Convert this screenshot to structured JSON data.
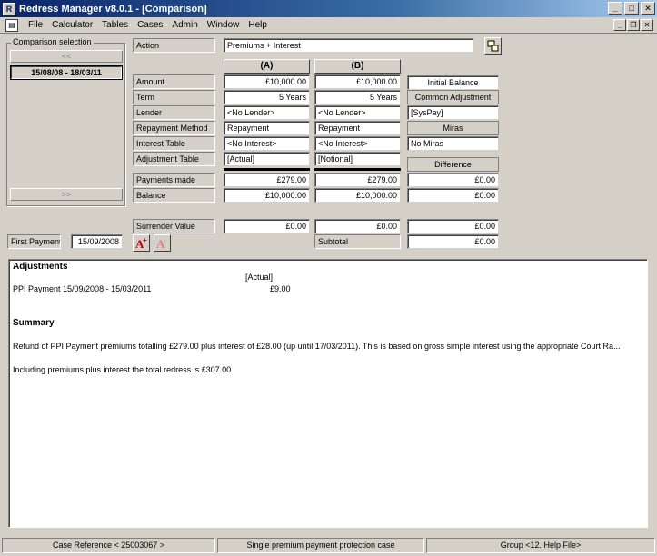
{
  "window": {
    "title": "Redress Manager v8.0.1 - [Comparison]",
    "controls": {
      "minimize": "_",
      "maximize": "□",
      "close": "✕"
    },
    "mdi_controls": {
      "minimize": "_",
      "restore": "❐",
      "close": "✕"
    }
  },
  "menu": [
    "File",
    "Calculator",
    "Tables",
    "Cases",
    "Admin",
    "Window",
    "Help"
  ],
  "comparison_selection": {
    "title": "Comparison selection",
    "prev_button": "<<",
    "next_button": ">>",
    "selected_item": "15/08/08 - 18/03/11"
  },
  "action": {
    "label": "Action",
    "value": "Premiums + Interest"
  },
  "columns": {
    "a": "(A)",
    "b": "(B)"
  },
  "rows": {
    "amount": {
      "label": "Amount",
      "a": "£10,000.00",
      "b": "£10,000.00"
    },
    "term": {
      "label": "Term",
      "a": "5 Years",
      "b": "5 Years"
    },
    "lender": {
      "label": "Lender",
      "a": "<No Lender>",
      "b": "<No Lender>"
    },
    "repayment_method": {
      "label": "Repayment Method",
      "a": "Repayment",
      "b": "Repayment"
    },
    "interest_table": {
      "label": "Interest Table",
      "a": "<No Interest>",
      "b": "<No Interest>"
    },
    "adjustment_table": {
      "label": "Adjustment Table",
      "a": "[Actual]",
      "b": "[Notional]"
    },
    "payments_made": {
      "label": "Payments made",
      "a": "£279.00",
      "b": "£279.00",
      "diff": "£0.00"
    },
    "balance": {
      "label": "Balance",
      "a": "£10,000.00",
      "b": "£10,000.00",
      "diff": "£0.00"
    },
    "surrender_value": {
      "label": "Surrender Value",
      "a": "£0.00",
      "b": "£0.00",
      "diff": "£0.00"
    }
  },
  "right_panel": {
    "initial_balance": "Initial Balance",
    "common_adjustment": "Common Adjustment",
    "syspay": "[SysPay]",
    "miras_header": "Miras",
    "miras_value": "No Miras",
    "difference_header": "Difference"
  },
  "subtotal": {
    "label": "Subtotal",
    "value": "£0.00"
  },
  "first_payment": {
    "label": "First Payment",
    "value": "15/09/2008"
  },
  "report": {
    "adjustments_title": "Adjustments",
    "adjustments_col_header": "[Actual]",
    "adjustment_row_label": "PPI Payment 15/09/2008 - 15/03/2011",
    "adjustment_row_value": "£9.00",
    "summary_title": "Summary",
    "summary_line1": "Refund of PPI Payment premiums totalling £279.00 plus interest of £28.00 (up until 17/03/2011). This is based on gross simple interest using the appropriate Court Ra...",
    "summary_line2": "Including premiums plus interest the total redress is £307.00."
  },
  "status": {
    "case_reference": "Case Reference < 25003067 >",
    "case_type": "Single premium payment protection case",
    "group": "Group <12. Help File>"
  },
  "icons": [
    "app-icon",
    "document-icon",
    "copy-icon",
    "add-font-icon",
    "remove-font-icon"
  ]
}
